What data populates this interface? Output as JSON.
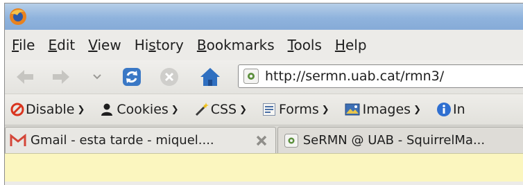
{
  "colors": {
    "titlebar": "#8fb3dd",
    "content_notice": "#fbf6bf",
    "disable_red": "#d9341e",
    "home_blue": "#2f6fc0",
    "reload_blue": "#3a78c5",
    "gmail_red": "#d44638"
  },
  "menubar": {
    "items": [
      {
        "pre": "",
        "mn": "F",
        "post": "ile"
      },
      {
        "pre": "",
        "mn": "E",
        "post": "dit"
      },
      {
        "pre": "",
        "mn": "V",
        "post": "iew"
      },
      {
        "pre": "Hi",
        "mn": "s",
        "post": "tory"
      },
      {
        "pre": "",
        "mn": "B",
        "post": "ookmarks"
      },
      {
        "pre": "",
        "mn": "T",
        "post": "ools"
      },
      {
        "pre": "",
        "mn": "H",
        "post": "elp"
      }
    ]
  },
  "navbar": {
    "url": "http://sermn.uab.cat/rmn3/",
    "icons": [
      "back-arrow-icon",
      "forward-arrow-icon",
      "history-dropdown-icon",
      "reload-icon",
      "stop-icon",
      "home-icon",
      "site-identity-icon"
    ]
  },
  "devbar": {
    "items": [
      {
        "label": "Disable",
        "icon": "disable-icon"
      },
      {
        "label": "Cookies",
        "icon": "cookies-icon"
      },
      {
        "label": "CSS",
        "icon": "css-wand-icon"
      },
      {
        "label": "Forms",
        "icon": "forms-icon"
      },
      {
        "label": "Images",
        "icon": "images-icon"
      },
      {
        "label": "In",
        "icon": "information-icon"
      }
    ]
  },
  "tabs": [
    {
      "title": "Gmail - esta tarde - miquel....",
      "icon": "gmail-icon",
      "closable": true
    },
    {
      "title": "SeRMN @ UAB - SquirrelMa...",
      "icon": "page-icon",
      "closable": false
    }
  ]
}
